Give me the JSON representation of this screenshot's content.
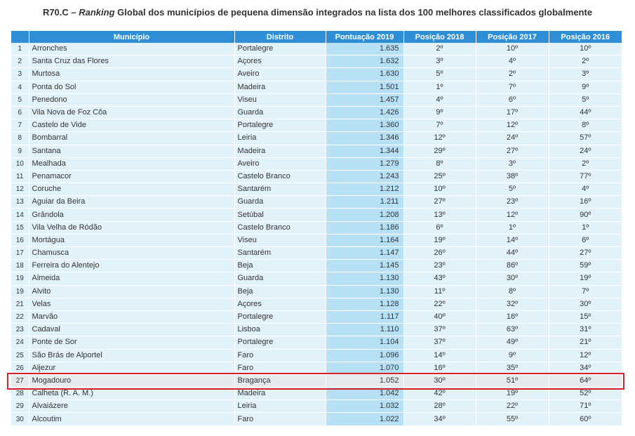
{
  "title_prefix": "R70.C – ",
  "title_italic": "Ranking",
  "title_rest": " Global dos municípios de pequena dimensão integrados na lista dos 100 melhores classificados globalmente",
  "headers": [
    "",
    "Município",
    "Distrito",
    "Pontuação 2019",
    "Posição 2018",
    "Posição 2017",
    "Posição 2016"
  ],
  "rows": [
    {
      "n": "1",
      "municipio": "Arronches",
      "distrito": "Portalegre",
      "score": "1.635",
      "p2018": "2º",
      "p2017": "10º",
      "p2016": "10º"
    },
    {
      "n": "2",
      "municipio": "Santa Cruz das Flores",
      "distrito": "Açores",
      "score": "1.632",
      "p2018": "3º",
      "p2017": "4º",
      "p2016": "2º"
    },
    {
      "n": "3",
      "municipio": "Murtosa",
      "distrito": "Aveiro",
      "score": "1.630",
      "p2018": "5º",
      "p2017": "2º",
      "p2016": "3º"
    },
    {
      "n": "4",
      "municipio": "Ponta do Sol",
      "distrito": "Madeira",
      "score": "1.501",
      "p2018": "1º",
      "p2017": "7º",
      "p2016": "9º"
    },
    {
      "n": "5",
      "municipio": "Penedono",
      "distrito": "Viseu",
      "score": "1.457",
      "p2018": "4º",
      "p2017": "6º",
      "p2016": "5º"
    },
    {
      "n": "6",
      "municipio": "Vila Nova de Foz Côa",
      "distrito": "Guarda",
      "score": "1.426",
      "p2018": "9º",
      "p2017": "17º",
      "p2016": "44º"
    },
    {
      "n": "7",
      "municipio": "Castelo de Vide",
      "distrito": "Portalegre",
      "score": "1.360",
      "p2018": "7º",
      "p2017": "12º",
      "p2016": "8º"
    },
    {
      "n": "8",
      "municipio": "Bombarral",
      "distrito": "Leiria",
      "score": "1.346",
      "p2018": "12º",
      "p2017": "24º",
      "p2016": "57º"
    },
    {
      "n": "9",
      "municipio": "Santana",
      "distrito": "Madeira",
      "score": "1.344",
      "p2018": "29º",
      "p2017": "27º",
      "p2016": "24º"
    },
    {
      "n": "10",
      "municipio": "Mealhada",
      "distrito": "Aveiro",
      "score": "1.279",
      "p2018": "8º",
      "p2017": "3º",
      "p2016": "2º"
    },
    {
      "n": "11",
      "municipio": "Penamacor",
      "distrito": "Castelo Branco",
      "score": "1.243",
      "p2018": "25º",
      "p2017": "38º",
      "p2016": "77º"
    },
    {
      "n": "12",
      "municipio": "Coruche",
      "distrito": "Santarém",
      "score": "1.212",
      "p2018": "10º",
      "p2017": "5º",
      "p2016": "4º"
    },
    {
      "n": "13",
      "municipio": "Aguiar da Beira",
      "distrito": "Guarda",
      "score": "1.211",
      "p2018": "27º",
      "p2017": "23º",
      "p2016": "16º"
    },
    {
      "n": "14",
      "municipio": "Grândola",
      "distrito": "Setúbal",
      "score": "1.208",
      "p2018": "13º",
      "p2017": "12º",
      "p2016": "90º"
    },
    {
      "n": "15",
      "municipio": "Vila Velha de Ródão",
      "distrito": "Castelo Branco",
      "score": "1.186",
      "p2018": "6º",
      "p2017": "1º",
      "p2016": "1º"
    },
    {
      "n": "16",
      "municipio": "Mortágua",
      "distrito": "Viseu",
      "score": "1.164",
      "p2018": "19º",
      "p2017": "14º",
      "p2016": "6º"
    },
    {
      "n": "17",
      "municipio": "Chamusca",
      "distrito": "Santarém",
      "score": "1.147",
      "p2018": "26º",
      "p2017": "44º",
      "p2016": "27º"
    },
    {
      "n": "18",
      "municipio": "Ferreira do Alentejo",
      "distrito": "Beja",
      "score": "1.145",
      "p2018": "23º",
      "p2017": "86º",
      "p2016": "59º"
    },
    {
      "n": "19",
      "municipio": "Almeida",
      "distrito": "Guarda",
      "score": "1.130",
      "p2018": "43º",
      "p2017": "30º",
      "p2016": "19º"
    },
    {
      "n": "19",
      "municipio": "Alvito",
      "distrito": "Beja",
      "score": "1.130",
      "p2018": "11º",
      "p2017": "8º",
      "p2016": "7º"
    },
    {
      "n": "21",
      "municipio": "Velas",
      "distrito": "Açores",
      "score": "1.128",
      "p2018": "22º",
      "p2017": "32º",
      "p2016": "30º"
    },
    {
      "n": "22",
      "municipio": "Marvão",
      "distrito": "Portalegre",
      "score": "1.117",
      "p2018": "40º",
      "p2017": "16º",
      "p2016": "15º"
    },
    {
      "n": "23",
      "municipio": "Cadaval",
      "distrito": "Lisboa",
      "score": "1.110",
      "p2018": "37º",
      "p2017": "63º",
      "p2016": "31º"
    },
    {
      "n": "24",
      "municipio": "Ponte de Sor",
      "distrito": "Portalegre",
      "score": "1.104",
      "p2018": "37º",
      "p2017": "49º",
      "p2016": "21º"
    },
    {
      "n": "25",
      "municipio": "São Brás de Alportel",
      "distrito": "Faro",
      "score": "1.096",
      "p2018": "14º",
      "p2017": "9º",
      "p2016": "12º"
    },
    {
      "n": "26",
      "municipio": "Aljezur",
      "distrito": "Faro",
      "score": "1.070",
      "p2018": "16º",
      "p2017": "35º",
      "p2016": "34º"
    },
    {
      "n": "27",
      "municipio": "Mogadouro",
      "distrito": "Bragança",
      "score": "1.052",
      "p2018": "30º",
      "p2017": "51º",
      "p2016": "64º",
      "highlight": true
    },
    {
      "n": "28",
      "municipio": "Calheta (R. A. M.)",
      "distrito": "Madeira",
      "score": "1.042",
      "p2018": "42º",
      "p2017": "19º",
      "p2016": "52º"
    },
    {
      "n": "29",
      "municipio": "Alvaiázere",
      "distrito": "Leiria",
      "score": "1.032",
      "p2018": "28º",
      "p2017": "22º",
      "p2016": "71º"
    },
    {
      "n": "30",
      "municipio": "Alcoutim",
      "distrito": "Faro",
      "score": "1.022",
      "p2018": "34º",
      "p2017": "55º",
      "p2016": "60º"
    }
  ]
}
